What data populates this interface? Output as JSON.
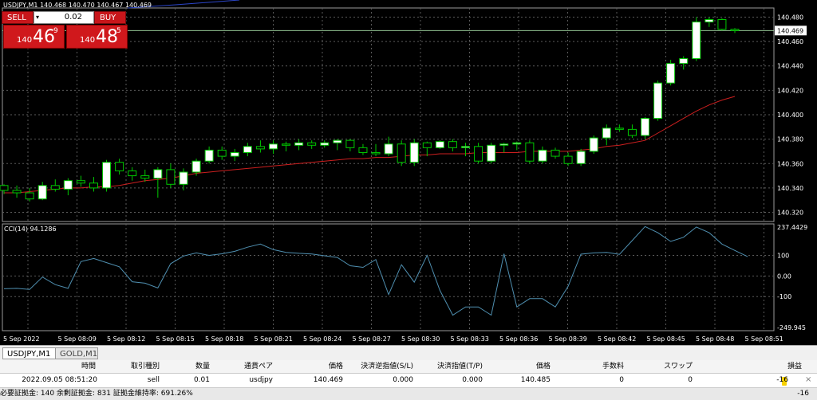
{
  "chart": {
    "title": "USDJPY,M1  140.468 140.470 140.467 140.469",
    "current_price": "140.469",
    "price_axis": [
      "140.480",
      "140.460",
      "140.440",
      "140.420",
      "140.400",
      "140.380",
      "140.360",
      "140.340",
      "140.320"
    ],
    "time_axis": [
      "5 Sep 2022",
      "5 Sep 08:09",
      "5 Sep 08:12",
      "5 Sep 08:15",
      "5 Sep 08:18",
      "5 Sep 08:21",
      "5 Sep 08:24",
      "5 Sep 08:27",
      "5 Sep 08:30",
      "5 Sep 08:33",
      "5 Sep 08:36",
      "5 Sep 08:39",
      "5 Sep 08:42",
      "5 Sep 08:45",
      "5 Sep 08:48",
      "5 Sep 08:51"
    ],
    "cci_label": "CCI(14) 94.1286",
    "cci_axis": [
      "237.4429",
      "100",
      "0.00",
      "-100",
      "-249.945"
    ],
    "colors": {
      "bull_fill": "#ffffff",
      "bear_fill": "#000000",
      "wick": "#00c800",
      "ma": "#cc1f1f",
      "cci": "#4f8fb0",
      "grid": "#5a5a5a"
    }
  },
  "candles": [
    [
      140.342,
      140.343,
      140.335,
      140.338
    ],
    [
      140.338,
      140.342,
      140.332,
      140.336
    ],
    [
      140.336,
      140.34,
      140.329,
      140.331
    ],
    [
      140.331,
      140.345,
      140.33,
      140.342
    ],
    [
      140.342,
      140.347,
      140.337,
      140.339
    ],
    [
      140.339,
      140.348,
      140.334,
      140.346
    ],
    [
      140.346,
      140.35,
      140.341,
      140.344
    ],
    [
      140.344,
      140.349,
      140.337,
      140.34
    ],
    [
      140.34,
      140.363,
      140.337,
      140.361
    ],
    [
      140.361,
      140.364,
      140.351,
      140.354
    ],
    [
      140.354,
      140.357,
      140.346,
      140.35
    ],
    [
      140.35,
      140.355,
      140.345,
      140.348
    ],
    [
      140.348,
      140.357,
      140.332,
      140.355
    ],
    [
      140.355,
      140.36,
      140.34,
      140.343
    ],
    [
      140.343,
      140.356,
      140.338,
      140.353
    ],
    [
      140.353,
      140.364,
      140.35,
      140.362
    ],
    [
      140.362,
      140.374,
      140.36,
      140.371
    ],
    [
      140.371,
      140.374,
      140.363,
      140.366
    ],
    [
      140.366,
      140.372,
      140.362,
      140.369
    ],
    [
      140.369,
      140.377,
      140.366,
      140.374
    ],
    [
      140.374,
      140.379,
      140.369,
      140.372
    ],
    [
      140.372,
      140.379,
      140.368,
      140.376
    ],
    [
      140.376,
      140.378,
      140.37,
      140.375
    ],
    [
      140.375,
      140.38,
      140.371,
      140.377
    ],
    [
      140.377,
      140.379,
      140.372,
      140.375
    ],
    [
      140.375,
      140.379,
      140.373,
      140.377
    ],
    [
      140.377,
      140.38,
      140.371,
      140.379
    ],
    [
      140.379,
      140.38,
      140.37,
      140.373
    ],
    [
      140.373,
      140.376,
      140.367,
      140.369
    ],
    [
      140.369,
      140.376,
      140.366,
      140.368
    ],
    [
      140.368,
      140.382,
      140.366,
      140.376
    ],
    [
      140.376,
      140.379,
      140.358,
      140.361
    ],
    [
      140.361,
      140.38,
      140.358,
      140.377
    ],
    [
      140.377,
      140.378,
      140.366,
      140.373
    ],
    [
      140.373,
      140.379,
      140.372,
      140.378
    ],
    [
      140.378,
      140.38,
      140.37,
      140.373
    ],
    [
      140.373,
      140.377,
      140.366,
      140.374
    ],
    [
      140.374,
      140.377,
      140.36,
      140.362
    ],
    [
      140.362,
      140.377,
      140.36,
      140.375
    ],
    [
      140.375,
      140.377,
      140.369,
      140.376
    ],
    [
      140.376,
      140.378,
      140.371,
      140.377
    ],
    [
      140.377,
      140.379,
      140.36,
      140.362
    ],
    [
      140.362,
      140.374,
      140.36,
      140.371
    ],
    [
      140.371,
      140.373,
      140.364,
      140.366
    ],
    [
      140.366,
      140.369,
      140.358,
      140.36
    ],
    [
      140.36,
      140.372,
      140.358,
      140.37
    ],
    [
      140.37,
      140.383,
      140.368,
      140.381
    ],
    [
      140.381,
      140.392,
      140.375,
      140.389
    ],
    [
      140.389,
      140.392,
      140.386,
      140.388
    ],
    [
      140.388,
      140.392,
      140.381,
      140.383
    ],
    [
      140.383,
      140.398,
      140.38,
      140.397
    ],
    [
      140.397,
      140.428,
      140.395,
      140.426
    ],
    [
      140.426,
      140.445,
      140.424,
      140.442
    ],
    [
      140.442,
      140.448,
      140.437,
      140.446
    ],
    [
      140.446,
      140.48,
      140.444,
      140.476
    ],
    [
      140.476,
      140.48,
      140.472,
      140.478
    ],
    [
      140.478,
      140.479,
      140.469,
      140.47
    ],
    [
      140.47,
      140.471,
      140.467,
      140.469
    ]
  ],
  "ma": [
    140.336,
    140.336,
    140.337,
    140.338,
    140.339,
    140.34,
    140.34,
    140.341,
    140.341,
    140.342,
    140.344,
    140.346,
    140.347,
    140.348,
    140.35,
    140.352,
    140.353,
    140.354,
    140.355,
    140.356,
    140.357,
    140.358,
    140.359,
    140.36,
    140.361,
    140.362,
    140.363,
    140.364,
    140.364,
    140.365,
    140.365,
    140.366,
    140.367,
    140.367,
    140.368,
    140.368,
    140.368,
    140.369,
    140.369,
    140.369,
    140.369,
    140.37,
    140.37,
    140.37,
    140.37,
    140.371,
    140.372,
    140.374,
    140.375,
    140.377,
    140.379,
    140.385,
    140.391,
    140.397,
    140.403,
    140.408,
    140.412,
    140.415
  ],
  "cci": [
    -62,
    -60,
    -65,
    -5,
    -42,
    -60,
    70,
    85,
    65,
    45,
    -28,
    -35,
    -58,
    60,
    97,
    112,
    100,
    108,
    120,
    140,
    155,
    128,
    115,
    110,
    107,
    98,
    90,
    50,
    42,
    80,
    -90,
    55,
    -30,
    100,
    -70,
    -190,
    -150,
    -150,
    -190,
    108,
    -150,
    -110,
    -110,
    -150,
    -50,
    106,
    112,
    115,
    105,
    172,
    240,
    210,
    168,
    188,
    238,
    210,
    155,
    124,
    94
  ],
  "tabs": [
    {
      "label": "USDJPY,M1",
      "active": true
    },
    {
      "label": "GOLD,M1",
      "active": false
    }
  ],
  "orders": {
    "headers": [
      "時間",
      "取引種別",
      "数量",
      "通貨ペア",
      "価格",
      "決済逆指値(S/L)",
      "決済指値(T/P)",
      "価格",
      "手数料",
      "スワップ",
      "損益"
    ],
    "row": [
      "2022.09.05 08:51:20",
      "sell",
      "0.01",
      "usdjpy",
      "140.469",
      "0.000",
      "0.000",
      "140.485",
      "0",
      "0",
      "-16"
    ],
    "summary": "必要証拠金: 140  余剰証拠金: 831  証拠金維持率: 691.26%",
    "summary_total": "-16",
    "close_symbol": "×"
  },
  "trade_panel": {
    "sell_label": "SELL",
    "buy_label": "BUY",
    "volume": "0.02",
    "volume_arrow": "▾",
    "bid_small": "140",
    "bid_big": "46",
    "bid_sup": "9",
    "ask_small": "140",
    "ask_big": "48",
    "ask_sup": "5"
  }
}
